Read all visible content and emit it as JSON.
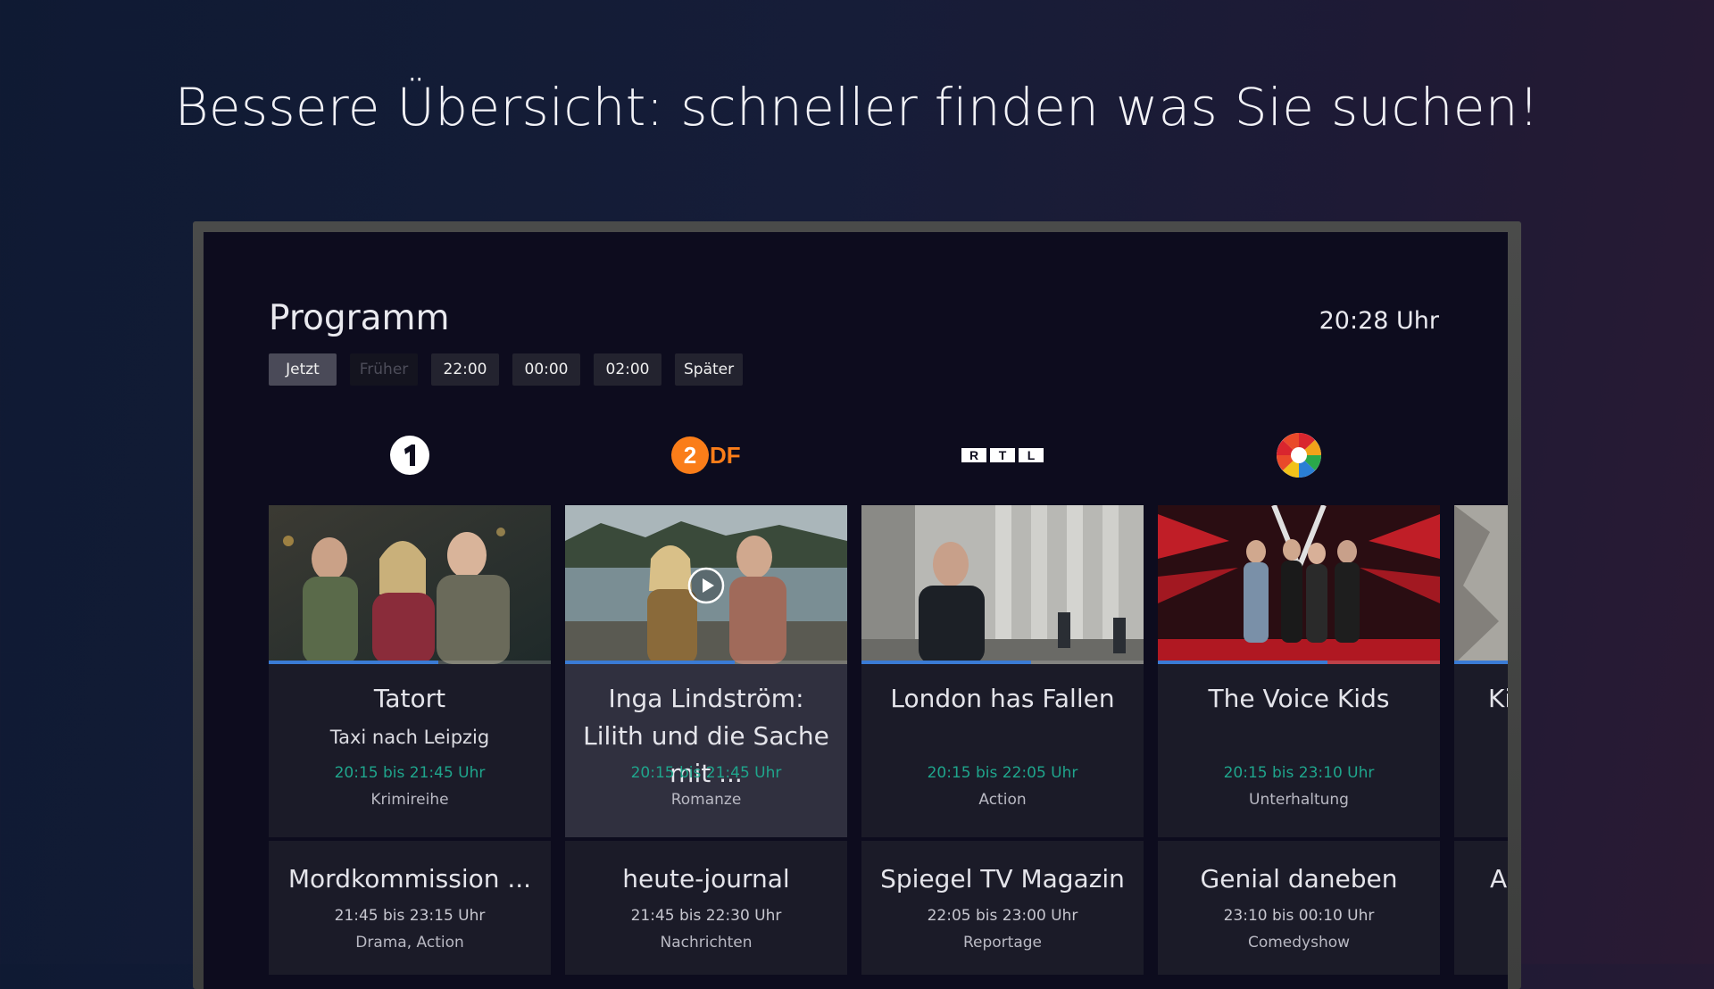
{
  "headline": "Bessere Übersicht: schneller finden was Sie suchen!",
  "header": {
    "title": "Programm",
    "clock": "20:28 Uhr"
  },
  "time_tabs": [
    {
      "label": "Jetzt",
      "state": "active"
    },
    {
      "label": "Früher",
      "state": "disabled"
    },
    {
      "label": "22:00",
      "state": "normal"
    },
    {
      "label": "00:00",
      "state": "normal"
    },
    {
      "label": "02:00",
      "state": "normal"
    },
    {
      "label": "Später",
      "state": "normal"
    }
  ],
  "channels": [
    {
      "icon": "das-erste-logo-icon",
      "logo_text": "1"
    },
    {
      "icon": "zdf-logo-icon",
      "logo_text": "2DF"
    },
    {
      "icon": "rtl-logo-icon",
      "logo_text": "RTL"
    },
    {
      "icon": "sat1-logo-icon",
      "logo_text": ""
    }
  ],
  "now_cards": [
    {
      "title": "Tatort",
      "subtitle": "Taxi nach Leipzig",
      "time": "20:15 bis 21:45 Uhr",
      "genre": "Krimireihe",
      "progress": 0.6,
      "focused": false
    },
    {
      "title": "Inga Lindström: Lilith und die Sache mit ...",
      "subtitle": "",
      "time": "20:15 bis 21:45 Uhr",
      "genre": "Romanze",
      "progress": 0.6,
      "focused": true
    },
    {
      "title": "London has Fallen",
      "subtitle": "",
      "time": "20:15 bis 22:05 Uhr",
      "genre": "Action",
      "progress": 0.6,
      "focused": false
    },
    {
      "title": "The Voice Kids",
      "subtitle": "",
      "time": "20:15 bis 23:10 Uhr",
      "genre": "Unterhaltung",
      "progress": 0.6,
      "focused": false
    }
  ],
  "partial_card": {
    "title": "Ki",
    "next_title": "A"
  },
  "next_cards": [
    {
      "title": "Mordkommission ...",
      "time": "21:45 bis 23:15 Uhr",
      "genre": "Drama, Action"
    },
    {
      "title": "heute-journal",
      "time": "21:45 bis 22:30 Uhr",
      "genre": "Nachrichten"
    },
    {
      "title": "Spiegel TV Magazin",
      "time": "22:05 bis 23:00 Uhr",
      "genre": "Reportage"
    },
    {
      "title": "Genial daneben",
      "time": "23:10 bis 00:10 Uhr",
      "genre": "Comedyshow"
    }
  ],
  "colors": {
    "accent_time": "#1fa58c",
    "progress": "#3a7bd5",
    "zdf_orange": "#fa7d19"
  }
}
